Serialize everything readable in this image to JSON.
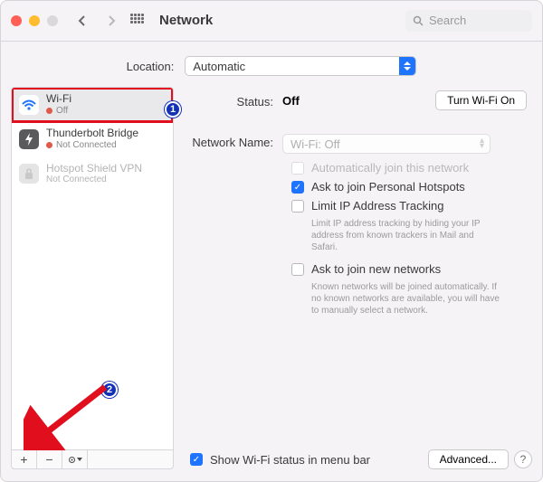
{
  "window": {
    "title": "Network"
  },
  "search": {
    "placeholder": "Search"
  },
  "location": {
    "label": "Location:",
    "value": "Automatic"
  },
  "sidebar": {
    "items": [
      {
        "name": "Wi-Fi",
        "status": "Off"
      },
      {
        "name": "Thunderbolt Bridge",
        "status": "Not Connected"
      },
      {
        "name": "Hotspot Shield VPN",
        "status": "Not Connected"
      }
    ]
  },
  "status": {
    "label": "Status:",
    "value": "Off",
    "toggle_button": "Turn Wi-Fi On"
  },
  "network_name": {
    "label": "Network Name:",
    "value": "Wi-Fi: Off"
  },
  "options": {
    "auto_join": {
      "label": "Automatically join this network",
      "checked": false,
      "enabled": false
    },
    "personal_hotspot": {
      "label": "Ask to join Personal Hotspots",
      "checked": true
    },
    "limit_ip": {
      "label": "Limit IP Address Tracking",
      "checked": false,
      "hint": "Limit IP address tracking by hiding your IP address from known trackers in Mail and Safari."
    },
    "ask_new": {
      "label": "Ask to join new networks",
      "checked": false,
      "hint": "Known networks will be joined automatically. If no known networks are available, you will have to manually select a network."
    }
  },
  "footer": {
    "menubar_label": "Show Wi-Fi status in menu bar",
    "menubar_checked": true,
    "advanced": "Advanced..."
  },
  "callouts": {
    "one": "1",
    "two": "2"
  }
}
